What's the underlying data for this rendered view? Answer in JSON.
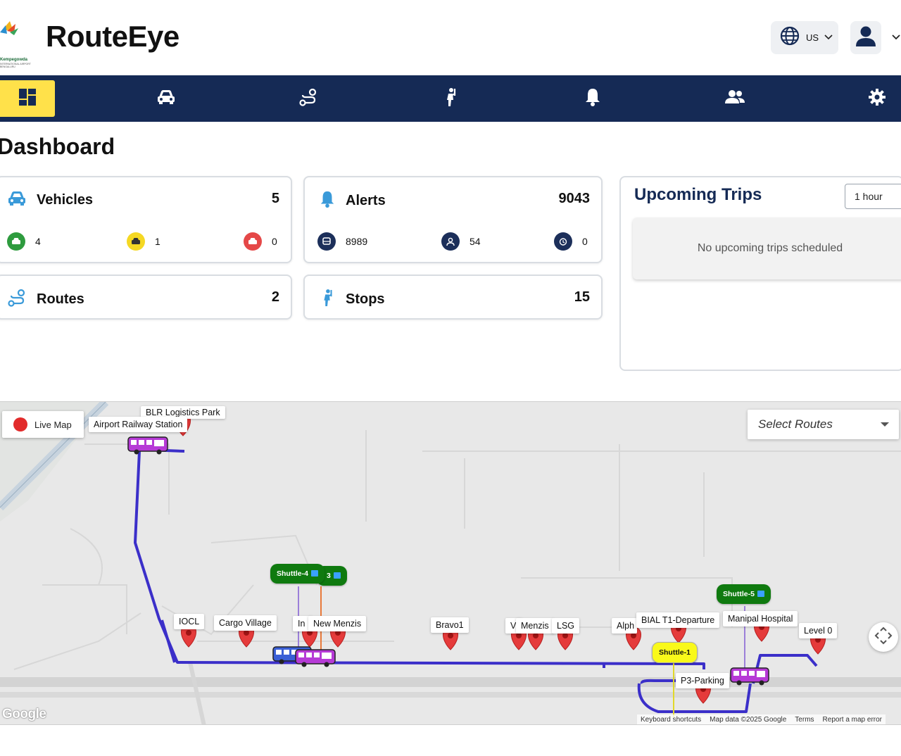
{
  "app": {
    "title": "RouteEye",
    "logo_text": "Kempegowda",
    "logo_subtext": "INTERNATIONAL AIRPORT BENGALURU"
  },
  "header": {
    "language_label": "US",
    "globe_icon": "globe-icon",
    "user_icon": "user-avatar-icon"
  },
  "nav": {
    "items": [
      {
        "icon": "dashboard-icon",
        "active": true
      },
      {
        "icon": "car-icon",
        "active": false
      },
      {
        "icon": "route-icon",
        "active": false
      },
      {
        "icon": "stop-person-icon",
        "active": false
      },
      {
        "icon": "bell-icon",
        "active": false
      },
      {
        "icon": "users-icon",
        "active": false
      },
      {
        "icon": "gear-icon",
        "active": false
      }
    ]
  },
  "dashboard": {
    "title": "Dashboard",
    "vehicles": {
      "label": "Vehicles",
      "count": "5",
      "stats": [
        {
          "value": "4",
          "color": "#2e9b3e",
          "icon": "car-icon"
        },
        {
          "value": "1",
          "color": "#f5d823",
          "icon": "car-icon"
        },
        {
          "value": "0",
          "color": "#e54848",
          "icon": "car-icon"
        }
      ]
    },
    "alerts": {
      "label": "Alerts",
      "count": "9043",
      "stats": [
        {
          "value": "8989",
          "icon": "bus-alert-icon"
        },
        {
          "value": "54",
          "icon": "person-alert-icon"
        },
        {
          "value": "0",
          "icon": "clock-alert-icon"
        }
      ]
    },
    "routes": {
      "label": "Routes",
      "count": "2"
    },
    "stops": {
      "label": "Stops",
      "count": "15"
    },
    "upcoming": {
      "title": "Upcoming Trips",
      "period": "1 hour",
      "empty_message": "No upcoming trips scheduled"
    }
  },
  "map": {
    "live_label": "Live Map",
    "route_select_placeholder": "Select Routes",
    "route_color": "#3b2fc9",
    "stop_labels": {
      "blr_logistics": "BLR Logistics Park",
      "airport_railway": "Airport Railway Station",
      "iocl": "IOCL",
      "cargo_village": "Cargo Village",
      "inc": "In",
      "new_menzis": "New Menzis",
      "bravo1": "Bravo1",
      "w": "V",
      "menzis": "Menzis",
      "lsg": "LSG",
      "alpha": "Alph",
      "bial_t1": "BIAL T1-Departure",
      "manipal": "Manipal Hospital",
      "level0": "Level 0",
      "p3_parking": "P3-Parking"
    },
    "shuttles": {
      "s4": "Shuttle-4",
      "s3": "3",
      "s5": "Shuttle-5",
      "s1": "Shuttle-1"
    },
    "attribution": {
      "google": "Google",
      "shortcuts": "Keyboard shortcuts",
      "mapdata": "Map data ©2025 Google",
      "terms": "Terms",
      "report": "Report a map error"
    }
  }
}
